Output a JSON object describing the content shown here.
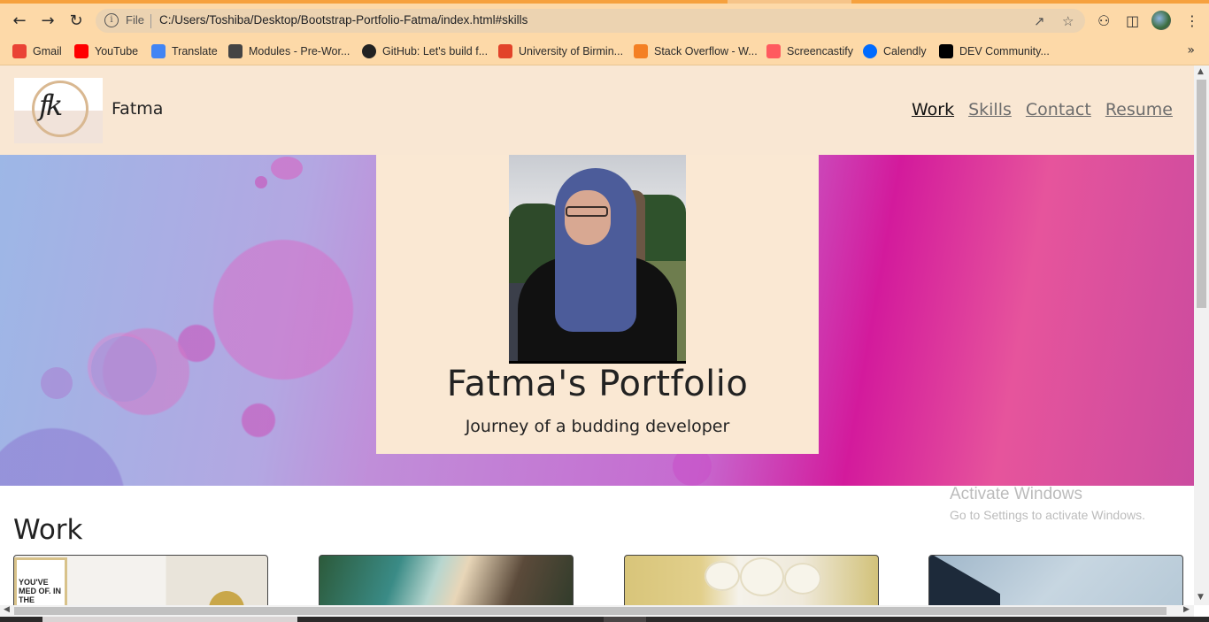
{
  "browser": {
    "file_label": "File",
    "url": "C:/Users/Toshiba/Desktop/Bootstrap-Portfolio-Fatma/index.html#skills",
    "bookmarks": [
      {
        "label": "Gmail",
        "icon": "gmail-icon",
        "color": "#ea4335"
      },
      {
        "label": "YouTube",
        "icon": "youtube-icon",
        "color": "#ff0000"
      },
      {
        "label": "Translate",
        "icon": "translate-icon",
        "color": "#4285f4"
      },
      {
        "label": "Modules - Pre-Wor...",
        "icon": "modules-icon",
        "color": "#444444"
      },
      {
        "label": "GitHub: Let's build f...",
        "icon": "github-icon",
        "color": "#222222"
      },
      {
        "label": "University of Birmin...",
        "icon": "gitlab-icon",
        "color": "#e24329"
      },
      {
        "label": "Stack Overflow - W...",
        "icon": "stackoverflow-icon",
        "color": "#f48024"
      },
      {
        "label": "Screencastify",
        "icon": "screencastify-icon",
        "color": "#ff5a5f"
      },
      {
        "label": "Calendly",
        "icon": "calendly-icon",
        "color": "#006bff"
      },
      {
        "label": "DEV Community...",
        "icon": "dev-icon",
        "color": "#000000"
      }
    ]
  },
  "site": {
    "logo_text": "fk",
    "brand": "Fatma",
    "nav": [
      {
        "label": "Work",
        "active": true
      },
      {
        "label": "Skills",
        "active": false
      },
      {
        "label": "Contact",
        "active": false
      },
      {
        "label": "Resume",
        "active": false
      }
    ],
    "hero": {
      "title": "Fatma's Portfolio",
      "subtitle": "Journey of a budding developer"
    },
    "work": {
      "title": "Work",
      "card1_poster_text": "YOU'VE MED OF. IN THE"
    }
  },
  "os": {
    "activate_title": "Activate Windows",
    "activate_sub": "Go to Settings to activate Windows."
  },
  "colors": {
    "navbar_bg": "#f9e7d3",
    "chrome_bg": "#fdd9a8",
    "hero_card_bg": "#fae8d3"
  }
}
